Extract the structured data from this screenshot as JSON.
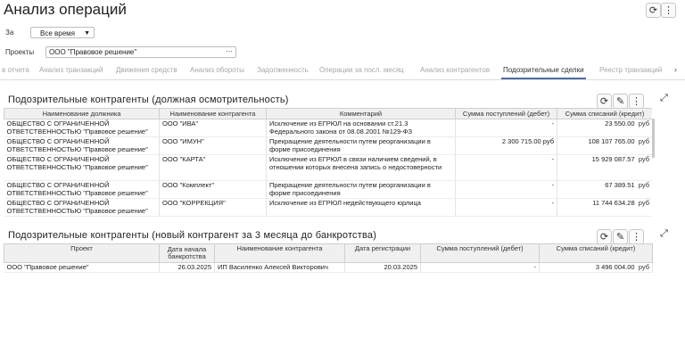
{
  "app": {
    "title": "Анализ операций"
  },
  "filters": {
    "period_label": "За",
    "period_value": "Все время",
    "projects_label": "Проекты",
    "projects_value": "ООО \"Правовое решение\"",
    "projects_button": "···"
  },
  "tabs": [
    "в отчета",
    "Анализ транзакций",
    "Движения средств",
    "Анализ обороты",
    "Задолженность",
    "Операции за посл. месяц",
    "Анализ контрагентов",
    "Подозрительные сделки",
    "Реестр транзакций"
  ],
  "active_tab": "Подозрительные сделки",
  "icons": {
    "refresh": "refresh-icon",
    "more": "more-vertical-icon",
    "settings": "wrench-icon",
    "expand": "expand-icon",
    "chevron": "chevron-down-icon",
    "next": "chevron-right-icon"
  },
  "panel1": {
    "title": "Подозрительные контрагенты (должная осмотрительность)",
    "columns": [
      "Наименование должника",
      "Наименование контрагента",
      "Комментарий",
      "Сумма поступлений (дебет)",
      "Сумма списаний (кредит)"
    ],
    "rows": [
      {
        "debtor": "ОБЩЕСТВО С ОГРАНИЧЕННОЙ ОТВЕТСТВЕННОСТЬЮ \"Правовое решение\"",
        "counterparty": "ООО \"ИВА\"",
        "comment": "Исключение из ЕГРЮЛ на основании ст.21.3 Федерального закона от 08.08.2001 №129-ФЗ",
        "debit": "-",
        "credit": "23 550.00",
        "cur": "руб"
      },
      {
        "debtor": "ОБЩЕСТВО С ОГРАНИЧЕННОЙ ОТВЕТСТВЕННОСТЬЮ \"Правовое решение\"",
        "counterparty": "ООО \"ИМУН\"",
        "comment": "Прекращение деятельности путем реорганизации в форме присоединения",
        "debit": "2 300 715.00  руб",
        "credit": "108 107 765.00",
        "cur": "руб"
      },
      {
        "debtor": "ОБЩЕСТВО С ОГРАНИЧЕННОЙ ОТВЕТСТВЕННОСТЬЮ \"Правовое решение\"",
        "counterparty": "ООО \"КАРТА\"",
        "comment": "Исключение из ЕГРЮЛ в связи наличием сведений, в отношении которых внесена запись о недостоверности",
        "debit": "-",
        "credit": "15 929 087.57",
        "cur": "руб"
      },
      {
        "debtor": "ОБЩЕСТВО С ОГРАНИЧЕННОЙ ОТВЕТСТВЕННОСТЬЮ \"Правовое решение\"",
        "counterparty": "ООО \"Комплект\"",
        "comment": "Прекращение деятельности путем реорганизации в форме присоединения",
        "debit": "-",
        "credit": "67 389.51",
        "cur": "руб"
      },
      {
        "debtor": "ОБЩЕСТВО С ОГРАНИЧЕННОЙ ОТВЕТСТВЕННОСТЬЮ \"Правовое решение\"",
        "counterparty": "ООО \"КОРРЕКЦИЯ\"",
        "comment": "Исключение из ЕГРЮЛ недействующего юрлица",
        "debit": "-",
        "credit": "11 744 634.28",
        "cur": "руб"
      }
    ]
  },
  "panel2": {
    "title": "Подозрительные контрагенты (новый контрагент за 3 месяца до банкротства)",
    "columns": [
      "Проект",
      "Дата начала банкротства",
      "Наименование контрагента",
      "Дата регистрации",
      "Сумма поступлений (дебет)",
      "Сумма списаний (кредит)"
    ],
    "rows": [
      {
        "project": "ООО \"Правовое решение\"",
        "start": "26.03.2025",
        "counterparty": "ИП Василенко Алексей Викторович",
        "reg": "20.03.2025",
        "debit": "-",
        "credit": "3 496 004.00",
        "cur": "руб"
      }
    ]
  }
}
